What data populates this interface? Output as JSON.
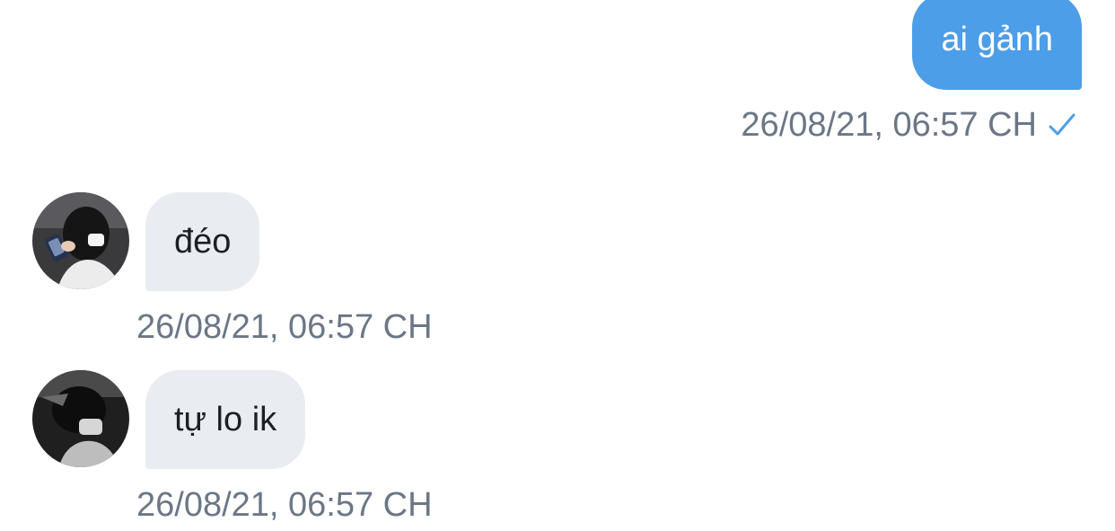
{
  "chat": {
    "messages": [
      {
        "direction": "outgoing",
        "text": "ai gảnh",
        "timestamp": "26/08/21, 06:57 CH",
        "status_icon": "check-icon"
      },
      {
        "direction": "incoming",
        "text": "đéo",
        "timestamp": "26/08/21, 06:57 CH",
        "avatar": "avatar-photo"
      },
      {
        "direction": "incoming",
        "text": "tự lo ik",
        "timestamp": "26/08/21, 06:57 CH",
        "avatar": "avatar-photo"
      }
    ]
  },
  "colors": {
    "outgoing_bubble": "#4c9ee8",
    "incoming_bubble": "#e9ecf0",
    "timestamp_text": "#6b7786",
    "check": "#4c9ee8"
  }
}
